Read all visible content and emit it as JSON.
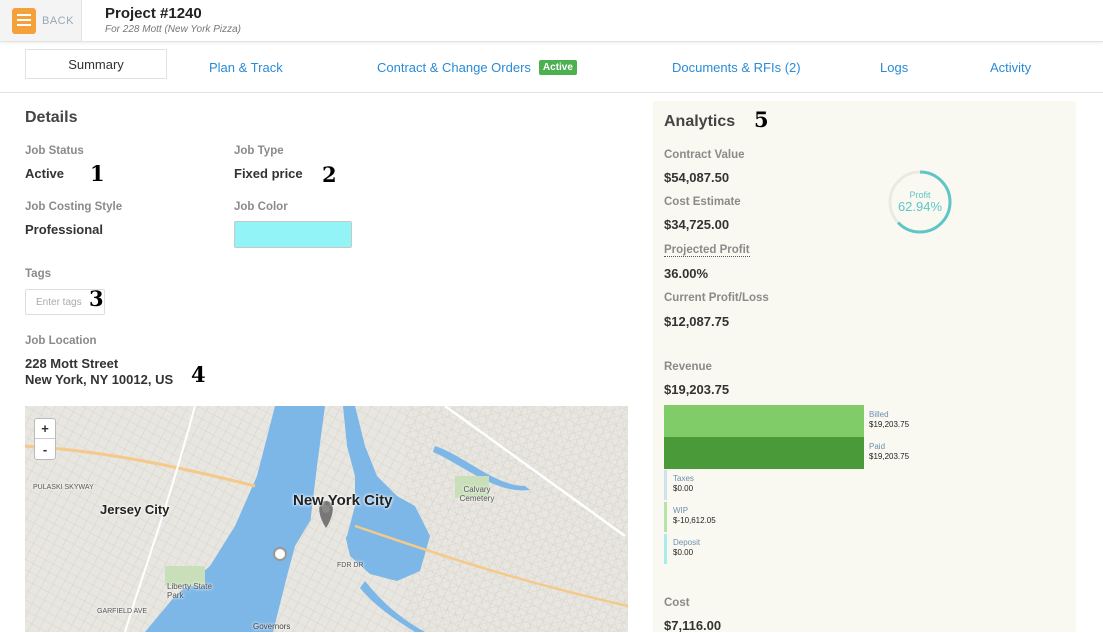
{
  "header": {
    "back_label": "BACK",
    "title": "Project #1240",
    "subtitle": "For 228 Mott (New York Pizza)"
  },
  "tabs": [
    {
      "label": "Summary"
    },
    {
      "label": "Plan & Track"
    },
    {
      "label": "Contract & Change Orders",
      "badge": "Active"
    },
    {
      "label": "Documents & RFIs (2)"
    },
    {
      "label": "Logs"
    },
    {
      "label": "Activity"
    }
  ],
  "details": {
    "heading": "Details",
    "job_status_label": "Job Status",
    "job_status": "Active",
    "job_type_label": "Job Type",
    "job_type": "Fixed price",
    "costing_label": "Job Costing Style",
    "costing": "Professional",
    "color_label": "Job Color",
    "color_value": "#93f4f7",
    "tags_label": "Tags",
    "tags_placeholder": "Enter tags",
    "location_label": "Job Location",
    "address_line1": "228 Mott Street",
    "address_line2": "New York, NY 10012, US"
  },
  "annotations": [
    "1",
    "2",
    "3",
    "4",
    "5"
  ],
  "map": {
    "zoom_in": "+",
    "zoom_out": "-",
    "labels": [
      "New York City",
      "Jersey City",
      "Calvary Cemetery",
      "Liberty State Park",
      "Governors",
      "PULASKI SKYWAY",
      "FDR DR",
      "GARFIELD AVE"
    ],
    "water_color": "#7cb7e8",
    "land_color": "#e8e6e0"
  },
  "analytics": {
    "heading": "Analytics",
    "contract_value_label": "Contract Value",
    "contract_value": "$54,087.50",
    "cost_estimate_label": "Cost Estimate",
    "cost_estimate": "$34,725.00",
    "projected_profit_label": "Projected Profit",
    "projected_profit": "36.00%",
    "current_pl_label": "Current Profit/Loss",
    "current_pl": "$12,087.75",
    "profit_ring_label": "Profit",
    "profit_ring_value": "62.94%",
    "profit_ring_fraction": 0.6294,
    "revenue_label": "Revenue",
    "revenue": "$19,203.75",
    "revenue_breakdown": [
      {
        "name": "Billed",
        "value": "$19,203.75",
        "color": "#7fcc68",
        "fraction": 1
      },
      {
        "name": "Paid",
        "value": "$19,203.75",
        "color": "#4a9a3a",
        "fraction": 1
      },
      {
        "name": "Taxes",
        "value": "$0.00",
        "color": "#cfe0ee",
        "fraction": 0
      },
      {
        "name": "WIP",
        "value": "$-10,612.05",
        "color": "#b8e3a8",
        "fraction": 0
      },
      {
        "name": "Deposit",
        "value": "$0.00",
        "color": "#a8ecec",
        "fraction": 0
      }
    ],
    "cost_label": "Cost",
    "cost": "$7,116.00"
  }
}
